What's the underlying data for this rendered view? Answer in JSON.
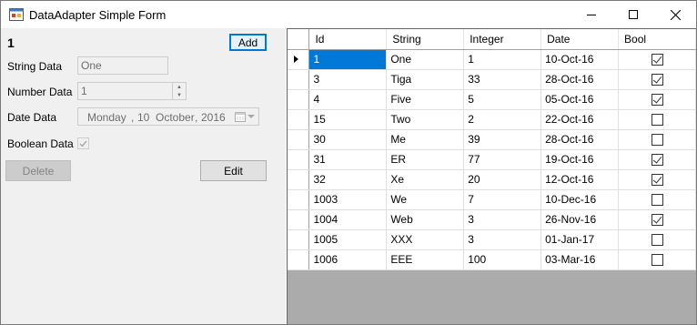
{
  "window": {
    "title": "DataAdapter Simple Form",
    "icon": "winforms-app-icon"
  },
  "form": {
    "id_value": "1",
    "add_label": "Add",
    "string_label": "String Data",
    "string_value": "One",
    "number_label": "Number Data",
    "number_value": "1",
    "date_label": "Date Data",
    "date_weekday": "Monday",
    "date_sep1": ",",
    "date_day": "10",
    "date_month": "October",
    "date_sep2": ",",
    "date_year": "2016",
    "boolean_label": "Boolean Data",
    "boolean_checked": true,
    "delete_label": "Delete",
    "edit_label": "Edit"
  },
  "grid": {
    "columns": [
      "Id",
      "String",
      "Integer",
      "Date",
      "Bool"
    ],
    "rows": [
      {
        "id": "1",
        "string": "One",
        "integer": "1",
        "date": "10-Oct-16",
        "bool": true,
        "selected": true
      },
      {
        "id": "3",
        "string": "Tiga",
        "integer": "33",
        "date": "28-Oct-16",
        "bool": true
      },
      {
        "id": "4",
        "string": "Five",
        "integer": "5",
        "date": "05-Oct-16",
        "bool": true
      },
      {
        "id": "15",
        "string": "Two",
        "integer": "2",
        "date": "22-Oct-16",
        "bool": false
      },
      {
        "id": "30",
        "string": "Me",
        "integer": "39",
        "date": "28-Oct-16",
        "bool": false
      },
      {
        "id": "31",
        "string": "ER",
        "integer": "77",
        "date": "19-Oct-16",
        "bool": true
      },
      {
        "id": "32",
        "string": "Xe",
        "integer": "20",
        "date": "12-Oct-16",
        "bool": true
      },
      {
        "id": "1003",
        "string": "We",
        "integer": "7",
        "date": "10-Dec-16",
        "bool": false
      },
      {
        "id": "1004",
        "string": "Web",
        "integer": "3",
        "date": "26-Nov-16",
        "bool": true
      },
      {
        "id": "1005",
        "string": "XXX",
        "integer": "3",
        "date": "01-Jan-17",
        "bool": false
      },
      {
        "id": "1006",
        "string": "EEE",
        "integer": "100",
        "date": "03-Mar-16",
        "bool": false
      }
    ]
  }
}
